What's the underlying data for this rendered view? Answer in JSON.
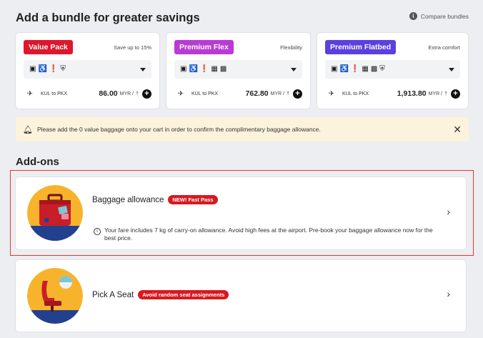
{
  "header": {
    "title": "Add a bundle for greater savings",
    "compare_label": "Compare bundles"
  },
  "bundles": [
    {
      "name": "Value Pack",
      "tagline": "Save up to 15%",
      "color": "#e0162b",
      "route": "KUL to PKX",
      "price": "86.00",
      "currency": "MYR /",
      "icons": [
        "luggage-icon",
        "wheelchair-icon",
        "meal-icon",
        "shield-icon"
      ]
    },
    {
      "name": "Premium Flex",
      "tagline": "Flexibility",
      "color": "#b93ad7",
      "route": "KUL to PKX",
      "price": "762.80",
      "currency": "MYR /",
      "icons": [
        "luggage-icon",
        "wheelchair-icon",
        "meal-icon",
        "calendar-icon",
        "seat-icon"
      ]
    },
    {
      "name": "Premium Flatbed",
      "tagline": "Extra comfort",
      "color": "#5b3fe0",
      "route": "KUL to PKX",
      "price": "1,913.80",
      "currency": "MYR /",
      "icons": [
        "luggage-icon",
        "wheelchair-icon",
        "meal-icon",
        "calendar-icon",
        "seat-icon",
        "shield-icon"
      ]
    }
  ],
  "notice": {
    "text": "Please add the 0 value baggage onto your cart in order to confirm the complimentary baggage allowance."
  },
  "addons": {
    "title": "Add-ons",
    "items": [
      {
        "title": "Baggage allowance",
        "badge": "NEW! Fast Pass",
        "description": "Your fare includes 7 kg of carry-on allowance. Avoid high fees at the airport. Pre-book your baggage allowance now for the best price."
      },
      {
        "title": "Pick A Seat",
        "badge": "Avoid random seat assignments"
      }
    ]
  },
  "colors": {
    "accent_red": "#d71920",
    "notice_bg": "#fbf3dc",
    "highlight_border": "#e53935"
  }
}
